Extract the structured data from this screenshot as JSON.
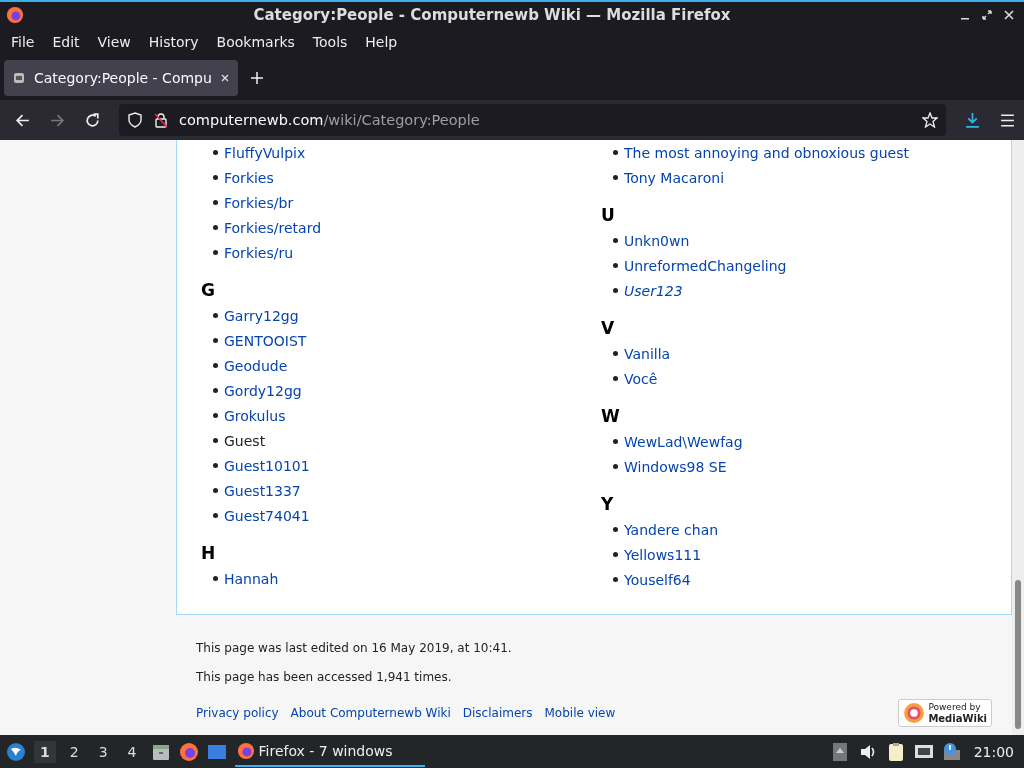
{
  "window": {
    "title": "Category:People - Computernewb Wiki — Mozilla Firefox"
  },
  "menu": [
    "File",
    "Edit",
    "View",
    "History",
    "Bookmarks",
    "Tools",
    "Help"
  ],
  "tabs": [
    {
      "label": "Category:People - Compu",
      "selected": true
    }
  ],
  "address": {
    "host": "computernewb.com",
    "path": "/wiki/Category:People"
  },
  "columns": [
    {
      "groups": [
        {
          "items": [
            {
              "label": "FluffyVulpix",
              "current": false,
              "redirect": false
            },
            {
              "label": "Forkies",
              "current": false,
              "redirect": false
            },
            {
              "label": "Forkies/br",
              "current": false,
              "redirect": false
            },
            {
              "label": "Forkies/retard",
              "current": false,
              "redirect": false
            },
            {
              "label": "Forkies/ru",
              "current": false,
              "redirect": false
            }
          ]
        },
        {
          "letter": "G",
          "items": [
            {
              "label": "Garry12gg",
              "current": false,
              "redirect": false
            },
            {
              "label": "GENTOOIST",
              "current": false,
              "redirect": false
            },
            {
              "label": "Geodude",
              "current": false,
              "redirect": false
            },
            {
              "label": "Gordy12gg",
              "current": false,
              "redirect": false
            },
            {
              "label": "Grokulus",
              "current": false,
              "redirect": false
            },
            {
              "label": "Guest",
              "current": true,
              "redirect": false
            },
            {
              "label": "Guest10101",
              "current": false,
              "redirect": false
            },
            {
              "label": "Guest1337",
              "current": false,
              "redirect": false
            },
            {
              "label": "Guest74041",
              "current": false,
              "redirect": false
            }
          ]
        },
        {
          "letter": "H",
          "items": [
            {
              "label": "Hannah",
              "current": false,
              "redirect": false
            }
          ]
        }
      ]
    },
    {
      "groups": [
        {
          "items": [
            {
              "label": "The most annoying and obnoxious guest",
              "current": false,
              "redirect": false
            },
            {
              "label": "Tony Macaroni",
              "current": false,
              "redirect": false
            }
          ]
        },
        {
          "letter": "U",
          "items": [
            {
              "label": "Unkn0wn",
              "current": false,
              "redirect": false
            },
            {
              "label": "UnreformedChangeling",
              "current": false,
              "redirect": false
            },
            {
              "label": "User123",
              "current": false,
              "redirect": true
            }
          ]
        },
        {
          "letter": "V",
          "items": [
            {
              "label": "Vanilla",
              "current": false,
              "redirect": false
            },
            {
              "label": "Você",
              "current": false,
              "redirect": false
            }
          ]
        },
        {
          "letter": "W",
          "items": [
            {
              "label": "WewLad\\Wewfag",
              "current": false,
              "redirect": false
            },
            {
              "label": "Windows98 SE",
              "current": false,
              "redirect": false
            }
          ]
        },
        {
          "letter": "Y",
          "items": [
            {
              "label": "Yandere chan",
              "current": false,
              "redirect": false
            },
            {
              "label": "Yellows111",
              "current": false,
              "redirect": false
            },
            {
              "label": "Youself64",
              "current": false,
              "redirect": false
            }
          ]
        }
      ]
    }
  ],
  "footer": {
    "info": [
      "This page was last edited on 16 May 2019, at 10:41.",
      "This page has been accessed 1,941 times."
    ],
    "links": [
      "Privacy policy",
      "About Computernewb Wiki",
      "Disclaimers",
      "Mobile view"
    ],
    "badge": {
      "line1": "Powered by",
      "line2": "MediaWiki"
    }
  },
  "taskbar": {
    "workspaces": [
      {
        "label": "1",
        "selected": true
      },
      {
        "label": "2",
        "selected": false
      },
      {
        "label": "3",
        "selected": false
      },
      {
        "label": "4",
        "selected": false
      }
    ],
    "task": "Firefox - 7 windows",
    "clock": "21:00"
  }
}
